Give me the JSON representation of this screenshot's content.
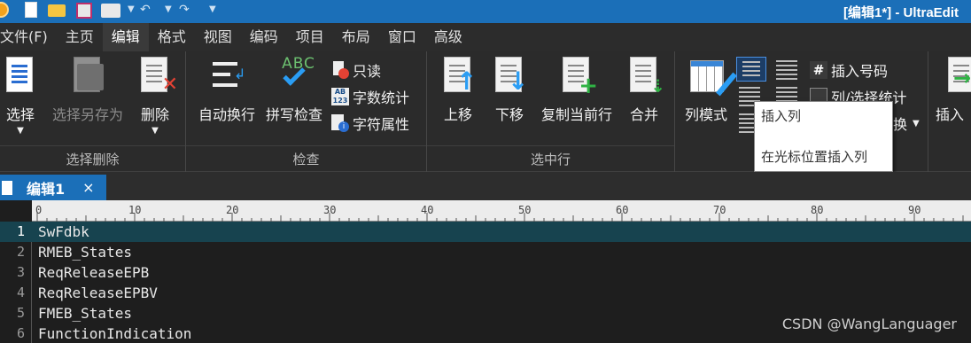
{
  "titlebar": {
    "title": "[编辑1*] - UltraEdit"
  },
  "menubar": {
    "items": [
      "文件(F)",
      "主页",
      "编辑",
      "格式",
      "视图",
      "编码",
      "项目",
      "布局",
      "窗口",
      "高级"
    ],
    "active": "编辑"
  },
  "ribbon": {
    "groups": {
      "select_delete": {
        "label": "选择删除",
        "select": "选择",
        "select_save_as": "选择另存为",
        "delete": "删除"
      },
      "check": {
        "label": "检查",
        "word_wrap": "自动换行",
        "spell_check": "拼写检查",
        "abc": "ABC",
        "read_only": "只读",
        "word_count": "字数统计",
        "char_props": "字符属性"
      },
      "select_line": {
        "label": "选中行",
        "move_up": "上移",
        "move_down": "下移",
        "dup_line": "复制当前行",
        "merge": "合并"
      },
      "column": {
        "column_mode": "列模式",
        "insert_number": "插入号码",
        "col_select_stats": "列/选择统计",
        "suffix_fragment": "换"
      },
      "insert": {
        "label": "插入"
      }
    }
  },
  "tooltip": {
    "title": "插入列",
    "description": "在光标位置插入列"
  },
  "tabs": [
    {
      "label": "编辑1",
      "close": "×"
    }
  ],
  "ruler": {
    "labels": [
      "0",
      "10",
      "20",
      "30",
      "40",
      "50",
      "60",
      "70",
      "80",
      "90"
    ]
  },
  "editor": {
    "lines": [
      {
        "num": "1",
        "text": "SwFdbk"
      },
      {
        "num": "2",
        "text": "RMEB_States"
      },
      {
        "num": "3",
        "text": "ReqReleaseEPB"
      },
      {
        "num": "4",
        "text": "ReqReleaseEPBV"
      },
      {
        "num": "5",
        "text": "FMEB_States"
      },
      {
        "num": "6",
        "text": "FunctionIndication"
      }
    ],
    "current_line": 1
  },
  "watermark": "CSDN @WangLanguager",
  "colors": {
    "titlebar": "#1b6fb8",
    "current_line": "#17434f",
    "accent_blue": "#2a9df4"
  }
}
